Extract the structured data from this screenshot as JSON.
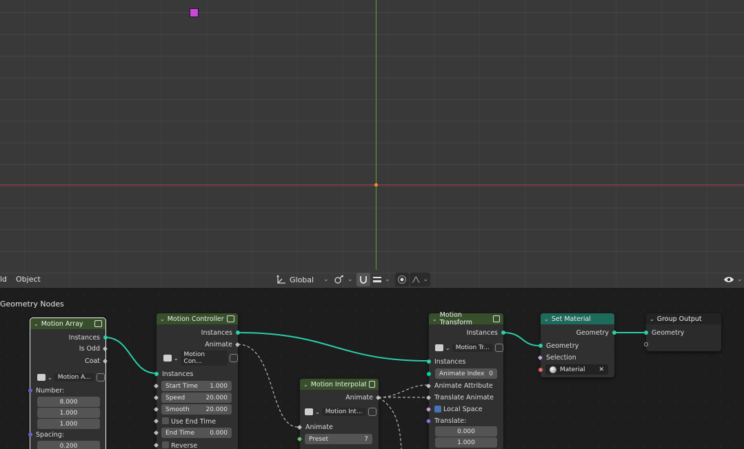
{
  "viewport": {
    "menu": {
      "world_partial": "ld",
      "object": "Object"
    },
    "transform_orientation": "Global",
    "colors": {
      "x_axis": "#b2384a",
      "y_axis": "#6c9b2a",
      "origin": "#f08c1e",
      "selected_object": "#c848d8"
    }
  },
  "node_editor": {
    "title": "Geometry Nodes",
    "nodes": {
      "motion_array": {
        "title": "Motion Array",
        "outputs": [
          "Instances",
          "Is Odd",
          "Coat"
        ],
        "group_name": "Motion A...",
        "number_label": "Number:",
        "number_values": [
          "8.000",
          "1.000",
          "1.000"
        ],
        "spacing_label": "Spacing:",
        "spacing_value": "0.200"
      },
      "motion_controller": {
        "title": "Motion Controller",
        "outputs": [
          "Instances",
          "Animate"
        ],
        "group_name": "Motion Con...",
        "input_instances": "Instances",
        "fields": [
          {
            "label": "Start Time",
            "value": "1.000"
          },
          {
            "label": "Speed",
            "value": "20.000"
          },
          {
            "label": "Smooth",
            "value": "20.000"
          }
        ],
        "use_end_time": "Use End Time",
        "end_time_label": "End Time",
        "end_time_value": "0.000",
        "reverse": "Reverse"
      },
      "motion_interpolation": {
        "title": "Motion Interpolation",
        "output": "Animate",
        "group_name": "Motion Int...",
        "input_animate": "Animate",
        "preset_label": "Preset",
        "preset_value": "7"
      },
      "motion_transform": {
        "title": "Motion Transform",
        "output": "Instances",
        "group_name": "Motion Tr...",
        "input_instances": "Instances",
        "animate_index_label": "Animate Index",
        "animate_index_value": "0",
        "animate_attribute": "Animate Attribute",
        "translate_animate": "Translate Animate",
        "local_space": "Local Space",
        "translate_label": "Translate:",
        "translate_values": [
          "0.000",
          "1.000"
        ]
      },
      "set_material": {
        "title": "Set Material",
        "output": "Geometry",
        "input_geometry": "Geometry",
        "selection": "Selection",
        "material": "Material"
      },
      "group_output": {
        "title": "Group Output",
        "input_geometry": "Geometry"
      }
    },
    "colors": {
      "link": "#2ad0a7",
      "head_green": "#37502b",
      "head_teal": "#1e6a5b"
    }
  }
}
